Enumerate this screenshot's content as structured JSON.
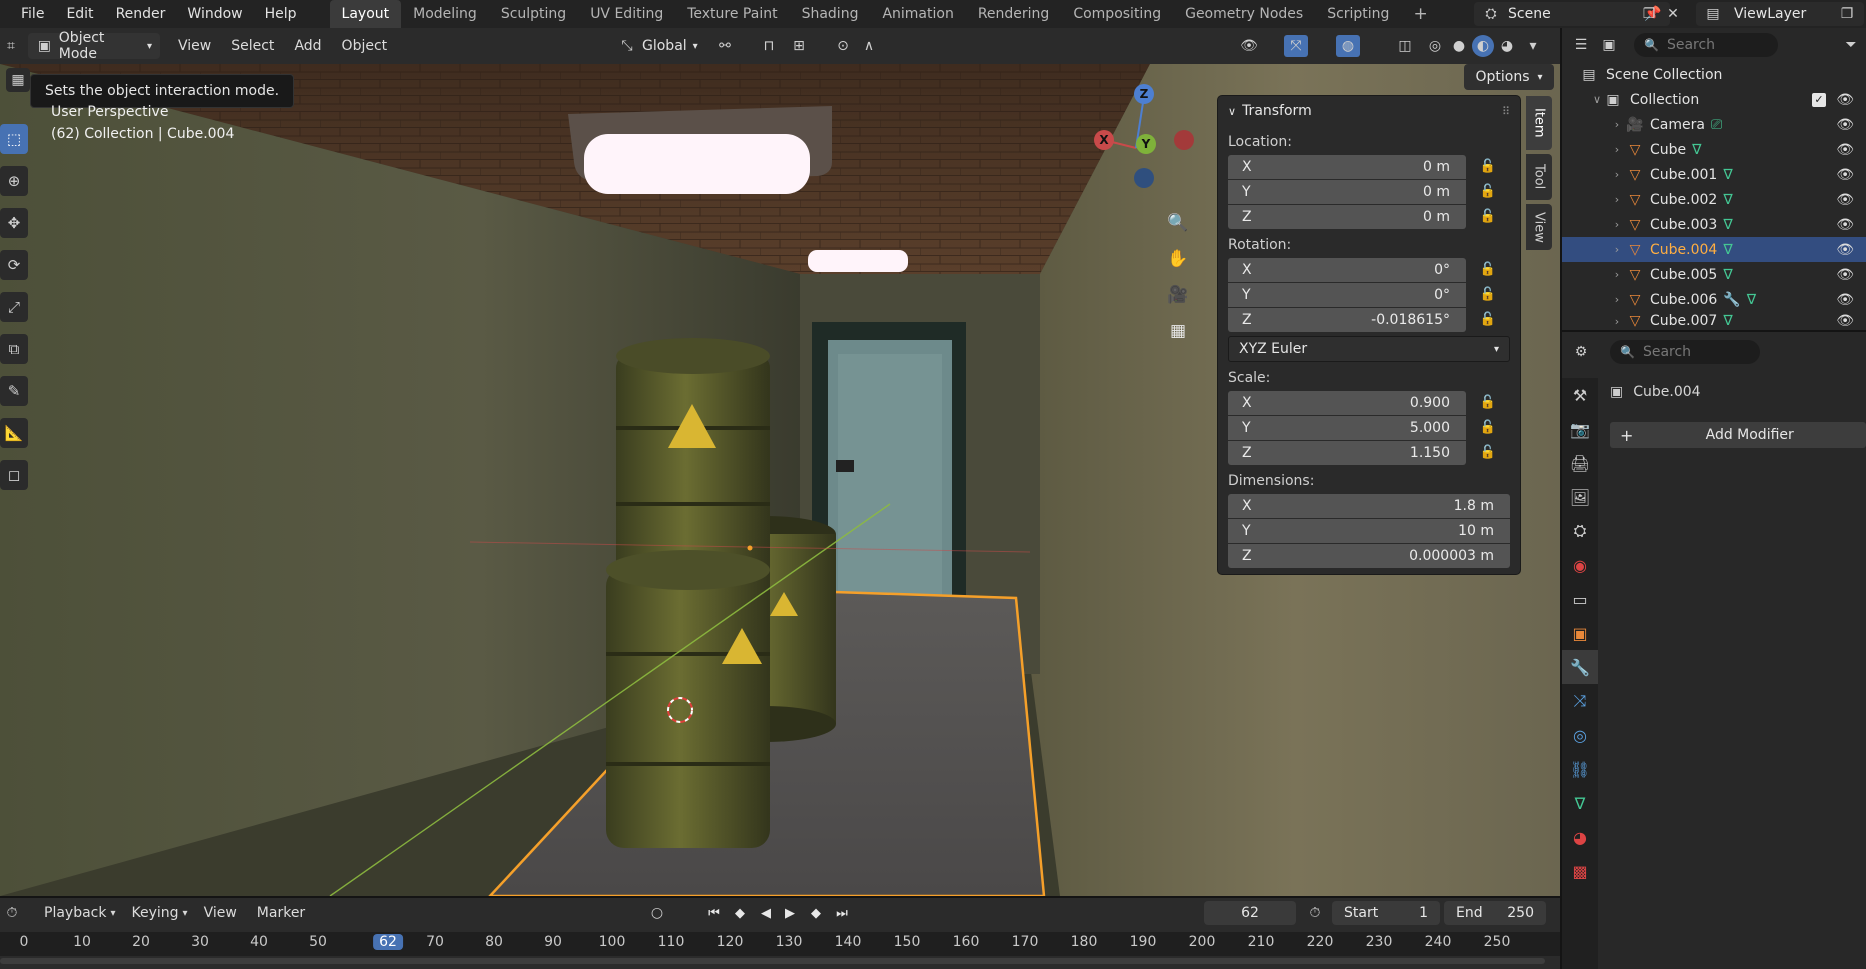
{
  "menu": {
    "items": [
      "File",
      "Edit",
      "Render",
      "Window",
      "Help"
    ]
  },
  "workspaces": {
    "tabs": [
      "Layout",
      "Modeling",
      "Sculpting",
      "UV Editing",
      "Texture Paint",
      "Shading",
      "Animation",
      "Rendering",
      "Compositing",
      "Geometry Nodes",
      "Scripting"
    ],
    "add": "+"
  },
  "scene": {
    "name": "Scene",
    "view_layer": "ViewLayer"
  },
  "viewport_header": {
    "mode": "Object Mode",
    "menus": [
      "View",
      "Select",
      "Add",
      "Object"
    ],
    "orientation": "Global",
    "options": "Options"
  },
  "viewport": {
    "tooltip": "Sets the object interaction mode.",
    "perspective": "User Perspective",
    "collection_info": "(62) Collection | Cube.004",
    "gizmo": {
      "x": "X",
      "y": "Y",
      "z": "Z"
    }
  },
  "sidebar_tabs": [
    "Item",
    "Tool",
    "View"
  ],
  "transform": {
    "title": "Transform",
    "location_label": "Location:",
    "location": [
      {
        "axis": "X",
        "value": "0 m"
      },
      {
        "axis": "Y",
        "value": "0 m"
      },
      {
        "axis": "Z",
        "value": "0 m"
      }
    ],
    "rotation_label": "Rotation:",
    "rotation": [
      {
        "axis": "X",
        "value": "0°"
      },
      {
        "axis": "Y",
        "value": "0°"
      },
      {
        "axis": "Z",
        "value": "-0.018615°"
      }
    ],
    "rotation_mode": "XYZ Euler",
    "scale_label": "Scale:",
    "scale": [
      {
        "axis": "X",
        "value": "0.900"
      },
      {
        "axis": "Y",
        "value": "5.000"
      },
      {
        "axis": "Z",
        "value": "1.150"
      }
    ],
    "dimensions_label": "Dimensions:",
    "dimensions": [
      {
        "axis": "X",
        "value": "1.8 m"
      },
      {
        "axis": "Y",
        "value": "10 m"
      },
      {
        "axis": "Z",
        "value": "0.000003 m"
      }
    ]
  },
  "outliner": {
    "search_placeholder": "Search",
    "scene_collection": "Scene Collection",
    "collection": "Collection",
    "items": [
      {
        "name": "Camera",
        "selected": false
      },
      {
        "name": "Cube",
        "selected": false
      },
      {
        "name": "Cube.001",
        "selected": false
      },
      {
        "name": "Cube.002",
        "selected": false
      },
      {
        "name": "Cube.003",
        "selected": false
      },
      {
        "name": "Cube.004",
        "selected": true
      },
      {
        "name": "Cube.005",
        "selected": false
      },
      {
        "name": "Cube.006",
        "selected": false
      },
      {
        "name": "Cube.007",
        "selected": false
      }
    ]
  },
  "properties": {
    "search_placeholder": "Search",
    "object_name": "Cube.004",
    "add_modifier": "Add Modifier",
    "add_icon": "+"
  },
  "timeline": {
    "menus": [
      "Playback",
      "Keying",
      "View",
      "Marker"
    ],
    "current_frame": "62",
    "start_label": "Start",
    "start": "1",
    "end_label": "End",
    "end": "250",
    "ruler_ticks": [
      "0",
      "10",
      "20",
      "30",
      "40",
      "50",
      "62",
      "70",
      "80",
      "90",
      "100",
      "110",
      "120",
      "130",
      "140",
      "150",
      "160",
      "170",
      "180",
      "190",
      "200",
      "210",
      "220",
      "230",
      "240",
      "250"
    ]
  },
  "colors": {
    "accent": "#4772b3",
    "selection": "#ffae42",
    "outliner_selected": "#334d80",
    "mesh_icon": "#44c794",
    "object_icon": "#e8883a"
  }
}
